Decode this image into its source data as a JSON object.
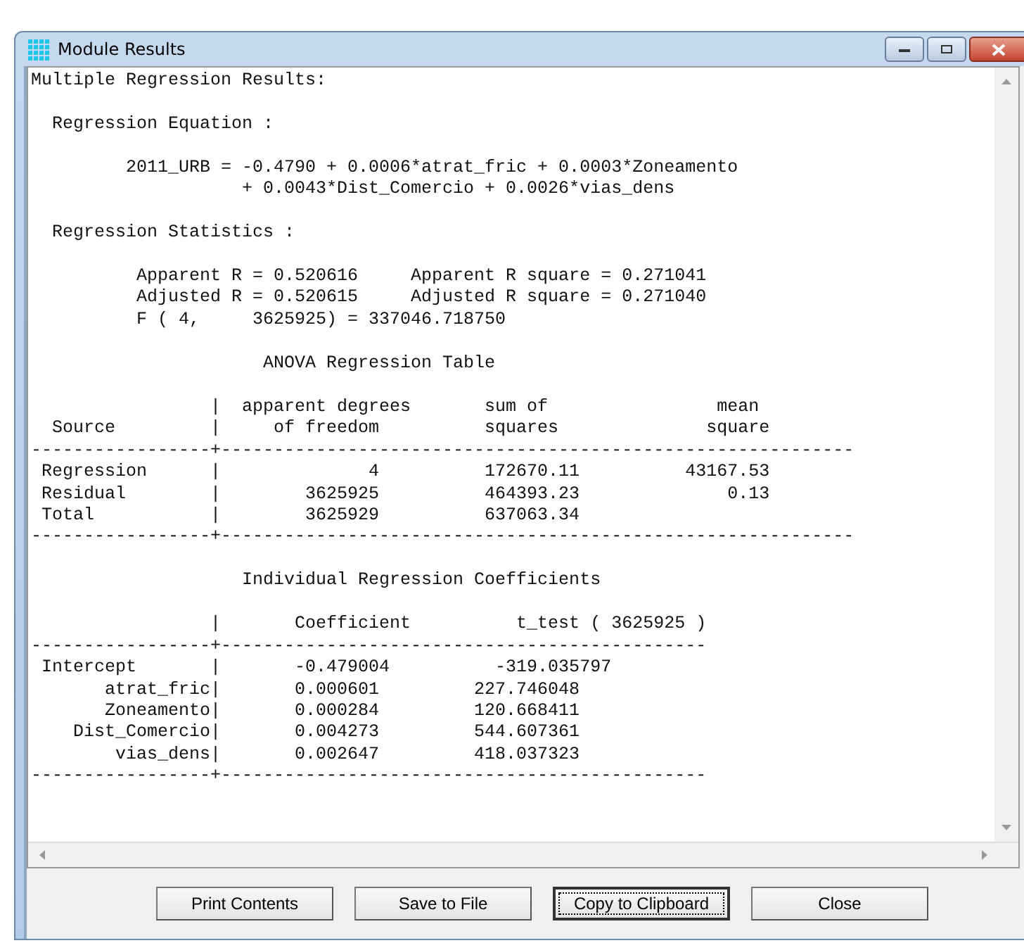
{
  "window": {
    "title": "Module Results"
  },
  "output_blocks": [
    {
      "kind": "text",
      "lines": [
        "Multiple Regression Results:"
      ]
    },
    {
      "kind": "text",
      "lines": [
        "  Regression Equation :"
      ]
    },
    {
      "kind": "text",
      "lines": [
        "         2011_URB = -0.4790 + 0.0006*atrat_fric + 0.0003*Zoneamento",
        "                    + 0.0043*Dist_Comercio + 0.0026*vias_dens"
      ]
    },
    {
      "kind": "text",
      "lines": [
        "  Regression Statistics :"
      ]
    },
    {
      "kind": "text",
      "lines": [
        "          Apparent R = 0.520616     Apparent R square = 0.271041",
        "          Adjusted R = 0.520615     Adjusted R square = 0.271040",
        "          F ( 4,     3625925) = 337046.718750"
      ]
    },
    {
      "kind": "table_title",
      "lines": [
        "                      ANOVA Regression Table"
      ]
    },
    {
      "kind": "text",
      "lines": [
        "                 |  apparent degrees       sum of                mean",
        "  Source         |     of freedom          squares              square",
        "-----------------+------------------------------------------------------------",
        " Regression      |              4          172670.11          43167.53",
        " Residual        |        3625925          464393.23              0.13",
        " Total           |        3625929          637063.34",
        "-----------------+------------------------------------------------------------"
      ]
    },
    {
      "kind": "table_title",
      "lines": [
        "                    Individual Regression Coefficients"
      ]
    },
    {
      "kind": "text",
      "lines": [
        "                 |       Coefficient          t_test ( 3625925 )",
        "-----------------+----------------------------------------------",
        " Intercept       |       -0.479004          -319.035797",
        "       atrat_fric|       0.000601         227.746048",
        "       Zoneamento|       0.000284         120.668411",
        "    Dist_Comercio|       0.004273         544.607361",
        "        vias_dens|       0.002647         418.037323",
        "-----------------+----------------------------------------------"
      ]
    }
  ],
  "buttons": [
    {
      "label": "Print Contents",
      "focused": false
    },
    {
      "label": "Save to File",
      "focused": false
    },
    {
      "label": "Copy to Clipboard",
      "focused": true
    },
    {
      "label": "Close",
      "focused": false
    }
  ]
}
